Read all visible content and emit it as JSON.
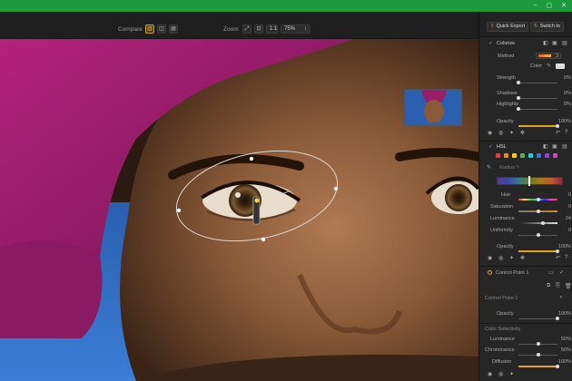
{
  "toolbar": {
    "compare_label": "Compare",
    "zoom_label": "Zoom",
    "zoom_one_to_one": "1:1",
    "zoom_value": "75%",
    "zoom_arrow": "↕"
  },
  "panel": {
    "quick_export": "Quick Export",
    "switch_to": "Switch to",
    "colorize": {
      "title": "Colorize",
      "method_label": "Method",
      "method_value": "3",
      "color_label": "Color",
      "sliders": [
        {
          "label": "Strength",
          "value": "0%",
          "fraction": 0.0
        },
        {
          "label": "Shadows",
          "value": "0%",
          "fraction": 0.0
        },
        {
          "label": "Highlights",
          "value": "0%",
          "fraction": 0.0
        }
      ],
      "opacity_label": "Opacity",
      "opacity_value": "100%",
      "opacity_fraction": 1.0
    },
    "hsl": {
      "title": "HSL",
      "radius_label": "Radius",
      "swatch_colors": [
        "#e04040",
        "#ff8a00",
        "#ffd000",
        "#3cc040",
        "#20d0d0",
        "#3070ff",
        "#9040d0",
        "#e040c0"
      ],
      "sliders": [
        {
          "label": "Hue",
          "value": "0",
          "fraction": 0.5
        },
        {
          "label": "Saturation",
          "value": "0",
          "fraction": 0.5
        },
        {
          "label": "Luminance",
          "value": "24",
          "fraction": 0.6
        },
        {
          "label": "Uniformity",
          "value": "0",
          "fraction": 0.5
        }
      ],
      "opacity_label": "Opacity",
      "opacity_value": "100%",
      "opacity_fraction": 1.0
    },
    "control_points": {
      "item_label": "Control Point 1",
      "section_title": "Control Point 1",
      "opacity_label": "Opacity",
      "opacity_value": "100%",
      "opacity_fraction": 1.0
    },
    "color_selectivity": {
      "title": "Color Selectivity",
      "sliders": [
        {
          "label": "Luminance",
          "value": "50%",
          "fraction": 0.5
        },
        {
          "label": "Chrominance",
          "value": "50%",
          "fraction": 0.5
        },
        {
          "label": "Diffusion",
          "value": "100%",
          "fraction": 1.0
        }
      ]
    }
  },
  "colors": {
    "title_bar": "#1d9a3e",
    "accent": "#e2a21a",
    "panel_bg": "#262626",
    "canvas_turban": "#9a1d6a",
    "canvas_sky": "#2f6fcf"
  },
  "icons": [
    "compare-side-by-side-icon",
    "compare-split-icon",
    "compare-trash-icon",
    "zoom-fit-icon",
    "zoom-fill-icon",
    "quick-export-icon",
    "switch-to-icon",
    "eyedropper-icon",
    "visibility-icon",
    "mask-icon",
    "reset-icon"
  ]
}
